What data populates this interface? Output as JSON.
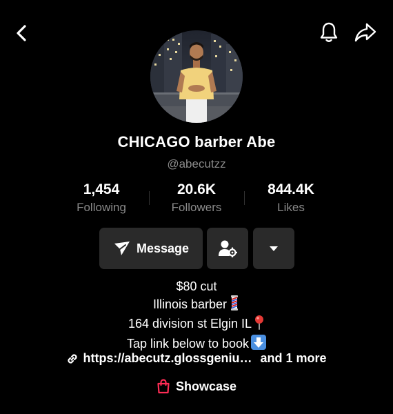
{
  "topbar": {
    "back_icon": "chevron-left-icon",
    "bell_icon": "bell-icon",
    "share_icon": "share-arrow-icon"
  },
  "profile": {
    "display_name": "CHICAGO barber Abe",
    "handle": "@abecutzz"
  },
  "stats": [
    {
      "value": "1,454",
      "label": "Following"
    },
    {
      "value": "20.6K",
      "label": "Followers"
    },
    {
      "value": "844.4K",
      "label": "Likes"
    }
  ],
  "actions": {
    "message_label": "Message",
    "message_icon": "send-plane-icon",
    "add_friend_icon": "person-settings-icon",
    "more_icon": "caret-down-icon"
  },
  "bio": {
    "lines": [
      "$80 cut",
      "Illinois barber",
      "164 division st Elgin IL",
      "Tap link below to book"
    ]
  },
  "link": {
    "url": "https://abecutz.glossgeniu…",
    "more": "and 1 more"
  },
  "showcase": {
    "label": "Showcase"
  },
  "colors": {
    "background": "#000000",
    "secondary_text": "#8a8a8a",
    "button_bg": "#2a2a2a",
    "showcase_red": "#fe2c55"
  }
}
